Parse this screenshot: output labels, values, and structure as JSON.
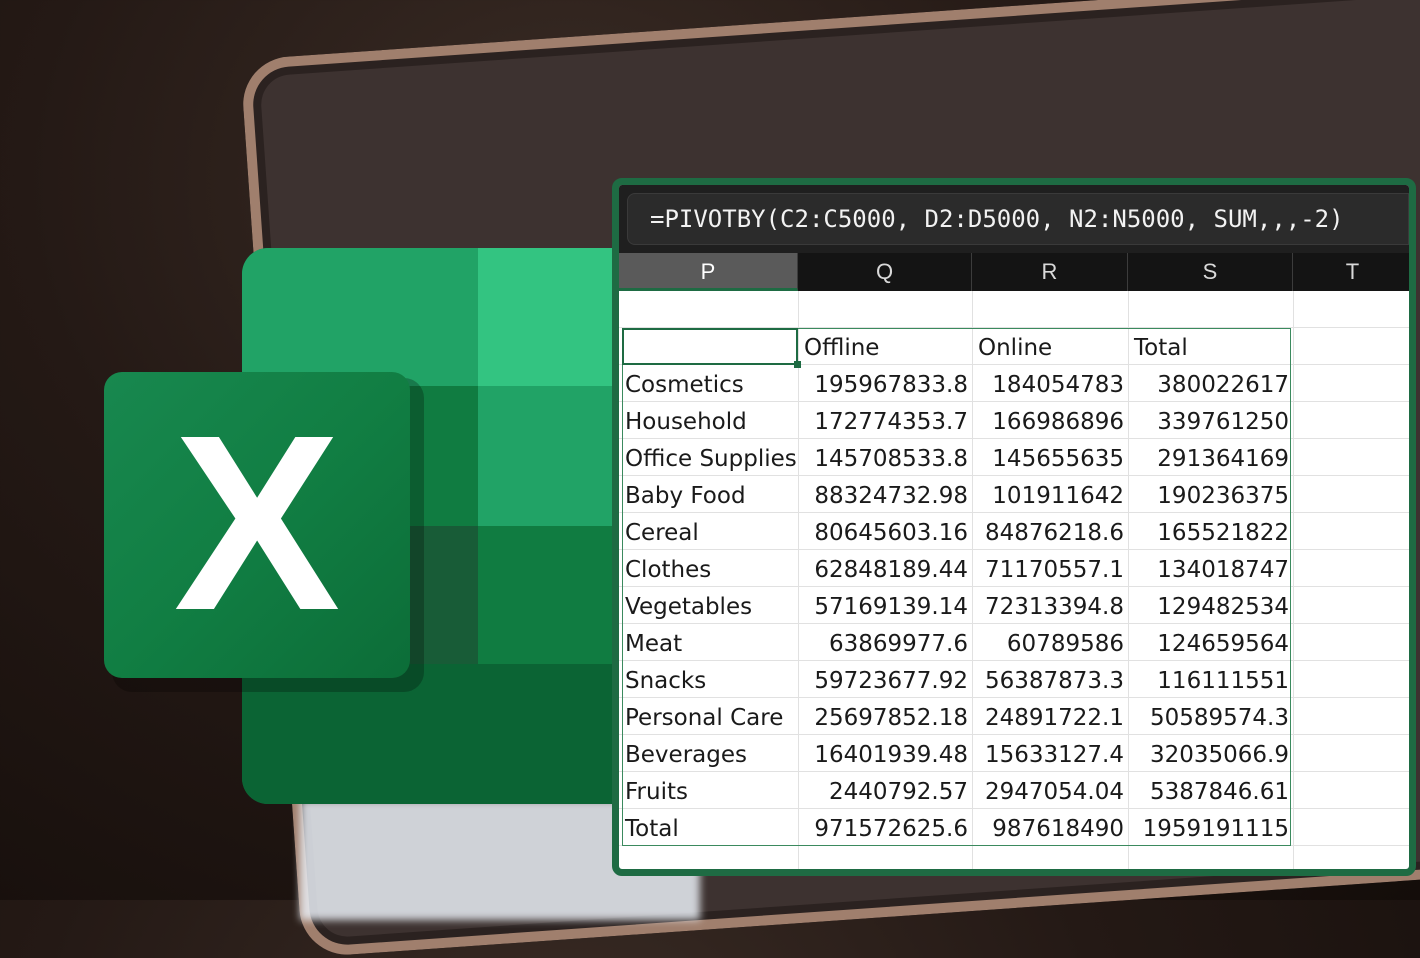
{
  "formula": "=PIVOTBY(C2:C5000, D2:D5000, N2:N5000, SUM,,,-2)",
  "logo": {
    "letter": "X"
  },
  "columns": [
    "P",
    "Q",
    "R",
    "S",
    "T"
  ],
  "selected_column": "P",
  "table": {
    "headers": [
      "",
      "Offline",
      "Online",
      "Total"
    ],
    "rows": [
      [
        "Cosmetics",
        "195967833.8",
        "184054783",
        "380022617"
      ],
      [
        "Household",
        "172774353.7",
        "166986896",
        "339761250"
      ],
      [
        "Office Supplies",
        "145708533.8",
        "145655635",
        "291364169"
      ],
      [
        "Baby Food",
        "88324732.98",
        "101911642",
        "190236375"
      ],
      [
        "Cereal",
        "80645603.16",
        "84876218.6",
        "165521822"
      ],
      [
        "Clothes",
        "62848189.44",
        "71170557.1",
        "134018747"
      ],
      [
        "Vegetables",
        "57169139.14",
        "72313394.8",
        "129482534"
      ],
      [
        "Meat",
        "63869977.6",
        "60789586",
        "124659564"
      ],
      [
        "Snacks",
        "59723677.92",
        "56387873.3",
        "116111551"
      ],
      [
        "Personal Care",
        "25697852.18",
        "24891722.1",
        "50589574.3"
      ],
      [
        "Beverages",
        "16401939.48",
        "15633127.4",
        "32035066.9"
      ],
      [
        "Fruits",
        "2440792.57",
        "2947054.04",
        "5387846.61"
      ],
      [
        "Total",
        "971572625.6",
        "987618490",
        "1959191115"
      ]
    ]
  },
  "colors": {
    "excel_green": "#107c41",
    "excel_light": "#33c481",
    "sheet_border": "#1e6b43"
  }
}
